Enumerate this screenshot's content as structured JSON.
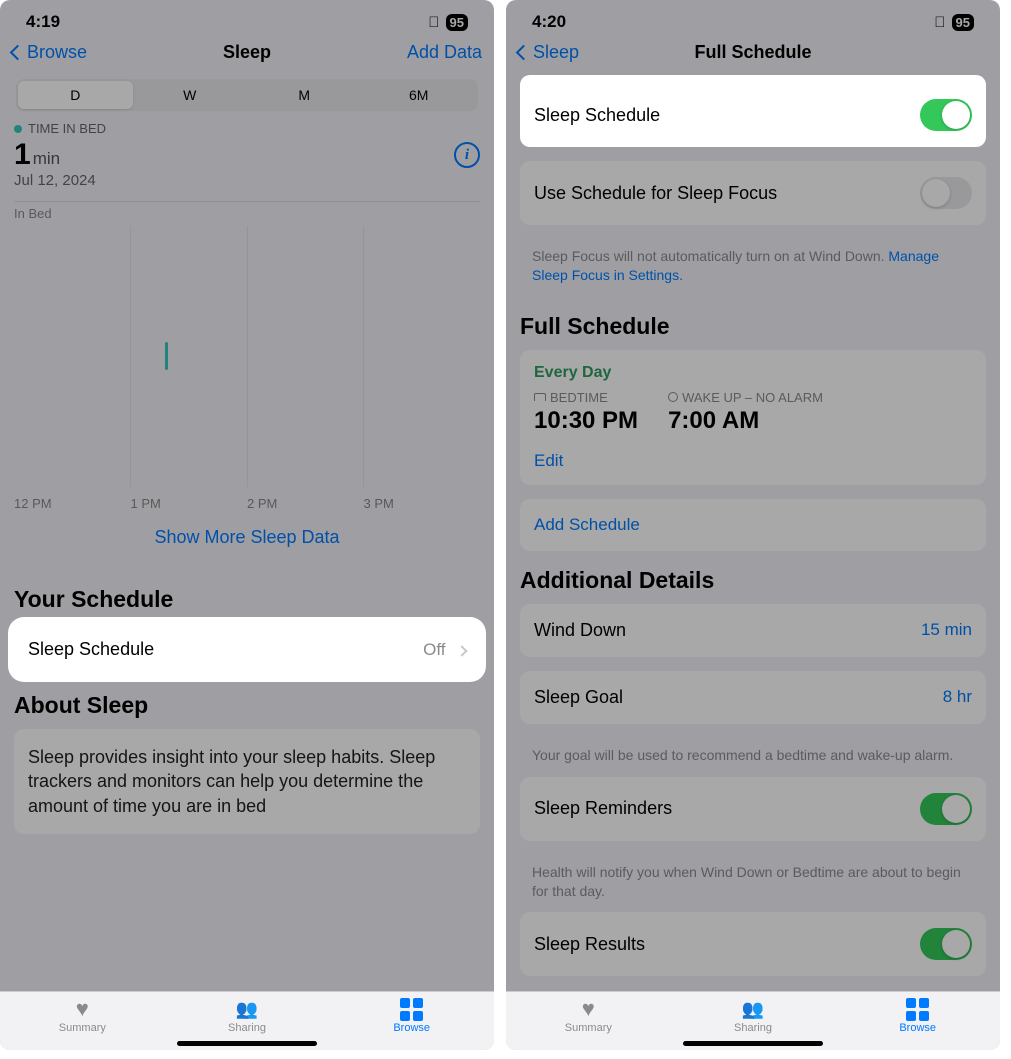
{
  "left": {
    "status": {
      "time": "4:19",
      "battery": "95"
    },
    "nav": {
      "back": "Browse",
      "title": "Sleep",
      "action": "Add Data"
    },
    "segments": [
      "D",
      "W",
      "M",
      "6M"
    ],
    "metric_label": "TIME IN BED",
    "metric_value": "1",
    "metric_unit": "min",
    "metric_date": "Jul 12, 2024",
    "chart_series_label": "In Bed",
    "chart_xticks": [
      "12 PM",
      "1 PM",
      "2 PM",
      "3 PM"
    ],
    "show_more": "Show More Sleep Data",
    "section_schedule": "Your Schedule",
    "schedule_row_label": "Sleep Schedule",
    "schedule_row_value": "Off",
    "section_about": "About Sleep",
    "about_text": "Sleep provides insight into your sleep habits. Sleep trackers and monitors can help you determine the amount of time you are in bed",
    "tabs": {
      "summary": "Summary",
      "sharing": "Sharing",
      "browse": "Browse"
    }
  },
  "right": {
    "status": {
      "time": "4:20",
      "battery": "95"
    },
    "nav": {
      "back": "Sleep",
      "title": "Full Schedule"
    },
    "row_sleep_schedule": "Sleep Schedule",
    "row_use_focus": "Use Schedule for Sleep Focus",
    "focus_note_1": "Sleep Focus will not automatically turn on at Wind Down. ",
    "focus_note_link": "Manage Sleep Focus in Settings.",
    "section_full": "Full Schedule",
    "every_day": "Every Day",
    "bedtime_label": "BEDTIME",
    "bedtime_value": "10:30 PM",
    "wake_label": "WAKE UP – NO ALARM",
    "wake_value": "7:00 AM",
    "edit": "Edit",
    "add_schedule": "Add Schedule",
    "section_additional": "Additional Details",
    "wind_down_label": "Wind Down",
    "wind_down_value": "15 min",
    "sleep_goal_label": "Sleep Goal",
    "sleep_goal_value": "8 hr",
    "goal_note": "Your goal will be used to recommend a bedtime and wake-up alarm.",
    "reminders_label": "Sleep Reminders",
    "reminders_note": "Health will notify you when Wind Down or Bedtime are about to begin for that day.",
    "results_label": "Sleep Results",
    "tabs": {
      "summary": "Summary",
      "sharing": "Sharing",
      "browse": "Browse"
    }
  },
  "chart_data": {
    "type": "bar",
    "title": "Time in Bed — Jul 12, 2024",
    "x_range_hours": [
      "12 PM",
      "1 PM",
      "2 PM",
      "3 PM",
      "4 PM"
    ],
    "series": [
      {
        "name": "In Bed",
        "events": [
          {
            "approx_hour": "1 PM–2 PM",
            "duration_min": 1
          }
        ]
      }
    ]
  }
}
